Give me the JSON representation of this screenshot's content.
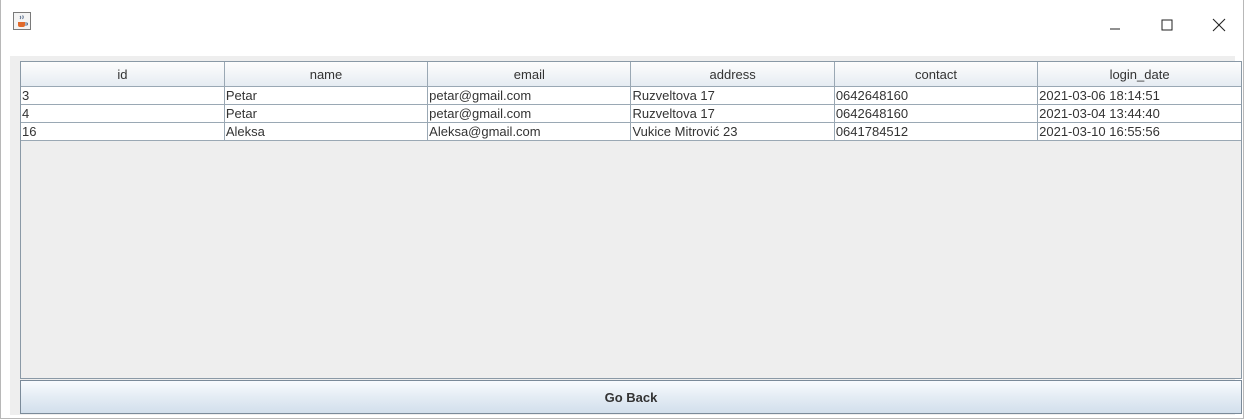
{
  "window": {
    "icon": "java-cup-icon",
    "controls": {
      "minimize": "minimize-icon",
      "maximize": "maximize-icon",
      "close": "close-icon"
    }
  },
  "table": {
    "columns": [
      "id",
      "name",
      "email",
      "address",
      "contact",
      "login_date"
    ],
    "rows": [
      [
        "3",
        "Petar",
        "petar@gmail.com",
        "Ruzveltova 17",
        "0642648160",
        "2021-03-06 18:14:51"
      ],
      [
        "4",
        "Petar",
        "petar@gmail.com",
        "Ruzveltova 17",
        "0642648160",
        "2021-03-04 13:44:40"
      ],
      [
        "16",
        "Aleksa",
        "Aleksa@gmail.com",
        "Vukice Mitrović 23",
        "0641784512",
        "2021-03-10 16:55:56"
      ]
    ]
  },
  "actions": {
    "go_back_label": "Go Back"
  },
  "colors": {
    "panel_background": "#eeeeee",
    "grid_line": "#9aa8b4",
    "text": "#333333"
  }
}
